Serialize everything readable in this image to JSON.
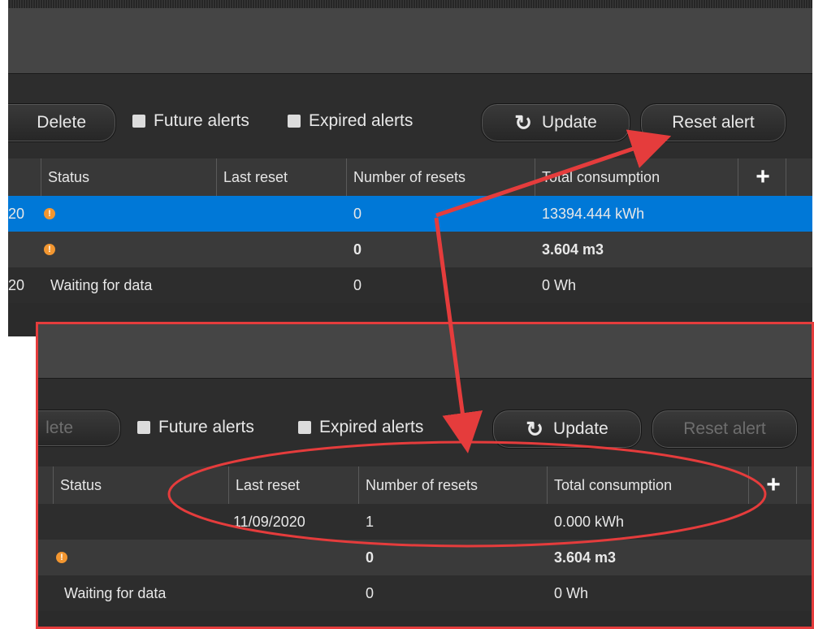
{
  "toolbar": {
    "delete_label_top": "Delete",
    "delete_label_bottom": "lete",
    "future_alerts": "Future alerts",
    "expired_alerts": "Expired alerts",
    "update": "Update",
    "reset_alert": "Reset alert"
  },
  "columns": {
    "status": "Status",
    "last_reset": "Last reset",
    "resets": "Number of resets",
    "total_top": "Total consumption",
    "total_bottom": "Total consumption"
  },
  "before": {
    "rows": [
      {
        "date_fragment": "20",
        "last_reset": "",
        "resets": "0",
        "total": "13394.444 kWh"
      },
      {
        "date_fragment": "",
        "last_reset": "",
        "resets": "0",
        "total": "3.604 m3"
      },
      {
        "date_fragment": "20",
        "status": "Waiting for data",
        "resets": "0",
        "total": "0 Wh"
      }
    ]
  },
  "after": {
    "rows": [
      {
        "last_reset": "11/09/2020",
        "resets": "1",
        "total": "0.000 kWh"
      },
      {
        "resets": "0",
        "total": "3.604 m3"
      },
      {
        "status": "Waiting for data",
        "resets": "0",
        "total": "0 Wh"
      }
    ]
  },
  "colors": {
    "selected_row": "#0078d7",
    "warning": "#f29630",
    "annotation": "#e53c3c"
  }
}
